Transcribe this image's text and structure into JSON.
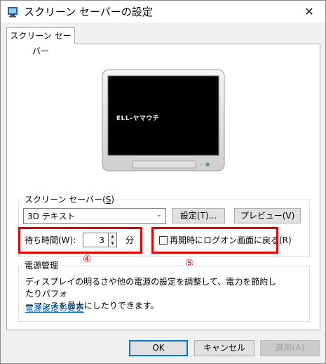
{
  "window": {
    "title": "スクリーン セーバーの設定",
    "close_glyph": "✕"
  },
  "tab": {
    "label": "スクリーン セーバー"
  },
  "preview": {
    "text": "ELL-ヤマウチ"
  },
  "screensaver_group": {
    "legend_prefix": "スクリーン セーバー(",
    "legend_key": "S",
    "legend_suffix": ")",
    "selected": "3D テキスト",
    "settings_button": "設定(T)...",
    "preview_button": "プレビュー(V)"
  },
  "wait": {
    "label": "待ち時間(W):",
    "value": "3",
    "unit": "分"
  },
  "logon_checkbox": {
    "label": "再開時にログオン画面に戻る(R)",
    "checked": false
  },
  "annotations": {
    "marker_4": "④",
    "marker_5": "⑤",
    "color": "#e00000"
  },
  "power_group": {
    "legend": "電源管理",
    "description_line1": "ディスプレイの明るさや他の電源の設定を調整して、電力を節約したりパフォ",
    "description_line2": "ーマンスを最大にしたりできます。",
    "link": "電源設定の変更"
  },
  "footer": {
    "ok": "OK",
    "cancel": "キャンセル",
    "apply": "適用(A)"
  },
  "icons": {
    "app": "screensaver-app-icon",
    "close": "close-icon",
    "dropdown": "chevron-down-icon",
    "spin_up": "spin-up-icon",
    "spin_down": "spin-down-icon"
  }
}
